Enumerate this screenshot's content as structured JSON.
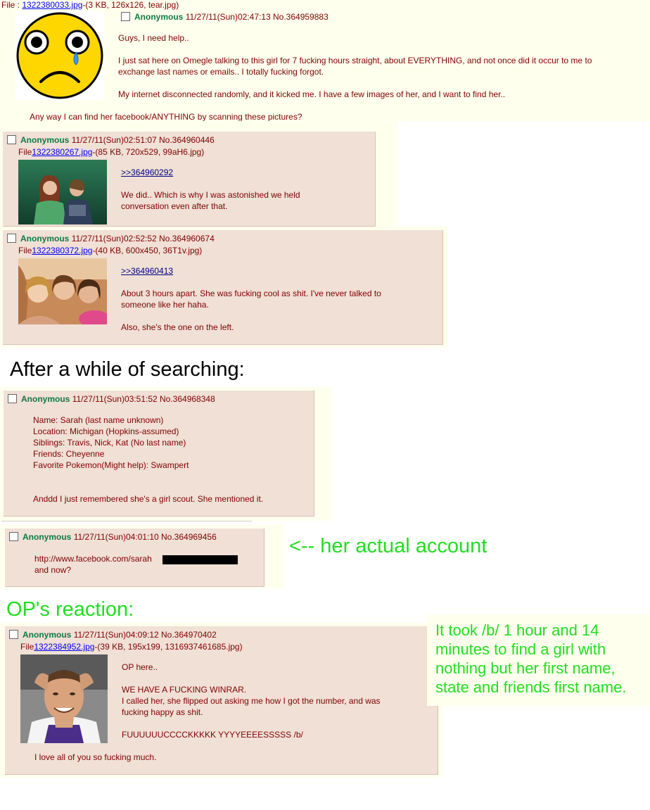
{
  "op": {
    "file_prefix": "File : ",
    "file_link": "1322380033.jpg",
    "file_info": "-(3 KB, 126x126, tear.jpg)",
    "name": "Anonymous",
    "datetime_no": "11/27/11(Sun)02:47:13 No.364959883",
    "lines": [
      "Guys, I need help..",
      "I just sat here on Omegle talking to this girl for 7 fucking hours straight, about EVERYTHING, and not once did it occur to me to",
      "exchange last names or emails.. I totally fucking forgot.",
      "My internet disconnected randomly, and it kicked me. I have a few images of her, and I want to find her..",
      "Any way I can find her facebook/ANYTHING by scanning these pictures?"
    ]
  },
  "post1": {
    "name": "Anonymous",
    "datetime_no": "11/27/11(Sun)02:51:07 No.364960446",
    "file_prefix": "File",
    "file_link": "1322380267.jpg",
    "file_info": "-(85 KB, 720x529, 99aH6.jpg)",
    "quote": ">>364960292",
    "lines": [
      "We did.. Which is why I was astonished we held",
      "conversation even after that."
    ]
  },
  "post2": {
    "name": "Anonymous",
    "datetime_no": "11/27/11(Sun)02:52:52 No.364960674",
    "file_prefix": "File",
    "file_link": "1322380372.jpg",
    "file_info": "-(40 KB, 600x450, 36T1v.jpg)",
    "quote": ">>364960413",
    "lines": [
      "About 3 hours apart. She was fucking cool as shit. I've never talked to",
      "someone like her haha.",
      "Also, she's the one on the left."
    ]
  },
  "caption_search": "After a while of searching:",
  "post3": {
    "name": "Anonymous",
    "datetime_no": "11/27/11(Sun)03:51:52 No.364968348",
    "lines": [
      "Name: Sarah (last name unknown)",
      "Location: Michigan (Hopkins-assumed)",
      "Siblings: Travis, Nick, Kat (No last name)",
      "Friends: Cheyenne",
      "Favorite Pokemon(Might help): Swampert",
      "Anddd I just remembered she's a girl scout. She mentioned it."
    ]
  },
  "post4": {
    "name": "Anonymous",
    "datetime_no": "11/27/11(Sun)04:01:10 No.364969456",
    "lines": [
      "http://www.facebook.com/sarah",
      "and now?"
    ]
  },
  "caption_account": "<-- her actual account",
  "caption_reaction": "OP's reaction:",
  "post5": {
    "name": "Anonymous",
    "datetime_no": "11/27/11(Sun)04:09:12 No.364970402",
    "file_prefix": "File",
    "file_link": "1322384952.jpg",
    "file_info": "-(39 KB, 195x199, 1316937461685.jpg)",
    "lines": [
      "OP here..",
      "WE HAVE A FUCKING WINRAR.",
      "I called her, she flipped out asking me how I got the number, and was",
      "fucking happy as shit.",
      "FUUUUUUCCCCKKKKK YYYYEEEESSSSS /b/",
      "I love all of you so fucking much."
    ]
  },
  "note": {
    "lines": [
      "It took /b/ 1 hour and 14",
      "minutes to find a girl with",
      "nothing but her first name,",
      "state and friends first name."
    ]
  },
  "colors": {
    "name": "#117743",
    "post_bg": "#f0e0d6",
    "page_bg": "#ffffee",
    "annotation": "#22dd22"
  }
}
